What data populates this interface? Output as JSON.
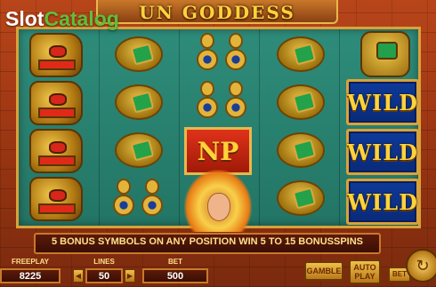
{
  "watermark": {
    "part1": "Slot",
    "part2": "Catalog"
  },
  "game": {
    "title": "UN GODDESS"
  },
  "reels": {
    "wild_label": "WILD",
    "np_label": "NP"
  },
  "message": "5 BONUS SYMBOLS ON ANY POSITION WIN 5 TO 15 BONUSSPINS",
  "controls": {
    "freeplay_label": "FREEPLAY",
    "freeplay_value": "8225",
    "lines_label": "LINES",
    "lines_value": "50",
    "bet_label": "BET",
    "bet_value": "500",
    "gamble_label": "GAMBLE",
    "autoplay_label": "AUTO PLAY",
    "betbtn_label": "BET",
    "minus": "◀",
    "plus": "▶"
  },
  "colors": {
    "reel_bg": "#2e8c7a",
    "frame": "#d9a23a",
    "text_gold": "#ffd23a"
  },
  "icons": {
    "spin": "refresh-arrows-icon"
  }
}
